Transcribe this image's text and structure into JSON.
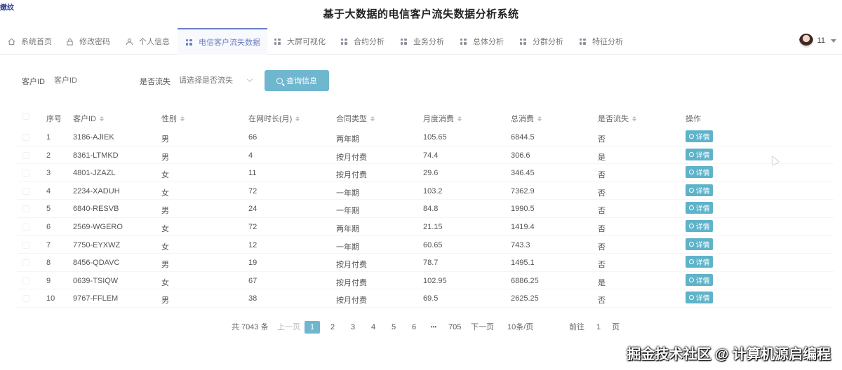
{
  "corner_logo": "嫩纹",
  "app_title": "基于大数据的电信客户流失数据分析系统",
  "nav": [
    {
      "label": "系统首页",
      "icon": "home-icon"
    },
    {
      "label": "修改密码",
      "icon": "lock-icon"
    },
    {
      "label": "个人信息",
      "icon": "user-icon"
    },
    {
      "label": "电信客户流失数据",
      "icon": "grid-icon",
      "active": true
    },
    {
      "label": "大屏可视化",
      "icon": "grid-icon"
    },
    {
      "label": "合约分析",
      "icon": "grid-icon"
    },
    {
      "label": "业务分析",
      "icon": "grid-icon"
    },
    {
      "label": "总体分析",
      "icon": "grid-icon"
    },
    {
      "label": "分群分析",
      "icon": "grid-icon"
    },
    {
      "label": "特征分析",
      "icon": "grid-icon"
    }
  ],
  "user": {
    "name": "11"
  },
  "search": {
    "customer_id_label": "客户ID",
    "customer_id_placeholder": "客户ID",
    "churn_label": "是否流失",
    "churn_placeholder": "请选择是否流失",
    "query_button": "查询信息"
  },
  "table": {
    "headers": [
      "序号",
      "客户ID",
      "性别",
      "在网时长(月)",
      "合同类型",
      "月度消费",
      "总消费",
      "是否流失",
      "操作"
    ],
    "action_label": "详情",
    "rows": [
      [
        "1",
        "3186-AJIEK",
        "男",
        "66",
        "两年期",
        "105.65",
        "6844.5",
        "否"
      ],
      [
        "2",
        "8361-LTMKD",
        "男",
        "4",
        "按月付费",
        "74.4",
        "306.6",
        "是"
      ],
      [
        "3",
        "4801-JZAZL",
        "女",
        "11",
        "按月付费",
        "29.6",
        "346.45",
        "否"
      ],
      [
        "4",
        "2234-XADUH",
        "女",
        "72",
        "一年期",
        "103.2",
        "7362.9",
        "否"
      ],
      [
        "5",
        "6840-RESVB",
        "男",
        "24",
        "一年期",
        "84.8",
        "1990.5",
        "否"
      ],
      [
        "6",
        "2569-WGERO",
        "女",
        "72",
        "两年期",
        "21.15",
        "1419.4",
        "否"
      ],
      [
        "7",
        "7750-EYXWZ",
        "女",
        "12",
        "一年期",
        "60.65",
        "743.3",
        "否"
      ],
      [
        "8",
        "8456-QDAVC",
        "男",
        "19",
        "按月付费",
        "78.7",
        "1495.1",
        "否"
      ],
      [
        "9",
        "0639-TSIQW",
        "女",
        "67",
        "按月付费",
        "102.95",
        "6886.25",
        "是"
      ],
      [
        "10",
        "9767-FFLEM",
        "男",
        "38",
        "按月付费",
        "69.5",
        "2625.25",
        "否"
      ]
    ]
  },
  "pagination": {
    "total_text": "共 7043 条",
    "prev": "上一页",
    "pages": [
      "1",
      "2",
      "3",
      "4",
      "5",
      "6"
    ],
    "ellipsis": "•••",
    "last_page": "705",
    "next": "下一页",
    "page_size": "10条/页",
    "goto_label": "前往",
    "goto_value": "1",
    "goto_suffix": "页"
  },
  "watermark": "掘金技术社区 @ 计算机源启编程"
}
